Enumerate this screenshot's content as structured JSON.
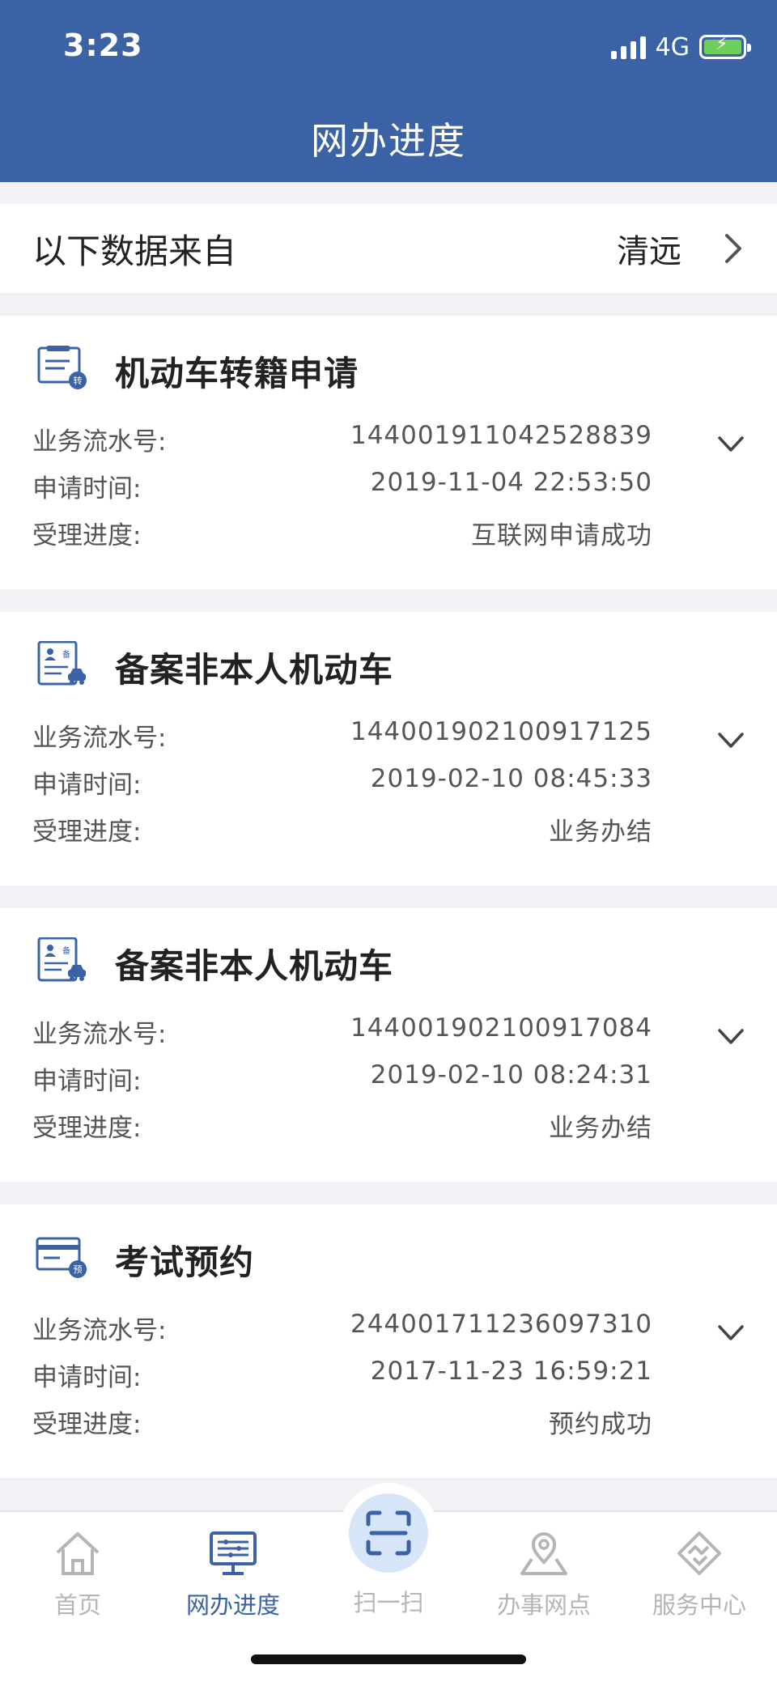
{
  "status_bar": {
    "time": "3:23",
    "network": "4G"
  },
  "header": {
    "title": "网办进度"
  },
  "source": {
    "label": "以下数据来自",
    "city": "清远"
  },
  "field_labels": {
    "serial": "业务流水号:",
    "time": "申请时间:",
    "progress": "受理进度:"
  },
  "records": [
    {
      "icon": "transfer-doc-icon",
      "badge": "转",
      "title": "机动车转籍申请",
      "serial": "144001911042528839",
      "time": "2019-11-04 22:53:50",
      "progress": "互联网申请成功"
    },
    {
      "icon": "filing-doc-icon",
      "badge": "备",
      "title": "备案非本人机动车",
      "serial": "144001902100917125",
      "time": "2019-02-10 08:45:33",
      "progress": "业务办结"
    },
    {
      "icon": "filing-doc-icon",
      "badge": "备",
      "title": "备案非本人机动车",
      "serial": "144001902100917084",
      "time": "2019-02-10 08:24:31",
      "progress": "业务办结"
    },
    {
      "icon": "exam-card-icon",
      "badge": "预",
      "title": "考试预约",
      "serial": "244001711236097310",
      "time": "2017-11-23 16:59:21",
      "progress": "预约成功"
    }
  ],
  "tabs": [
    {
      "label": "首页",
      "icon": "home-icon",
      "active": false
    },
    {
      "label": "网办进度",
      "icon": "monitor-icon",
      "active": true
    },
    {
      "label": "扫一扫",
      "icon": "scan-icon",
      "active": false
    },
    {
      "label": "办事网点",
      "icon": "location-icon",
      "active": false
    },
    {
      "label": "服务中心",
      "icon": "handshake-icon",
      "active": false
    }
  ],
  "colors": {
    "primary": "#3a62a4",
    "inactive": "#b5b5b5",
    "scan_bg": "#d6e6f8"
  }
}
